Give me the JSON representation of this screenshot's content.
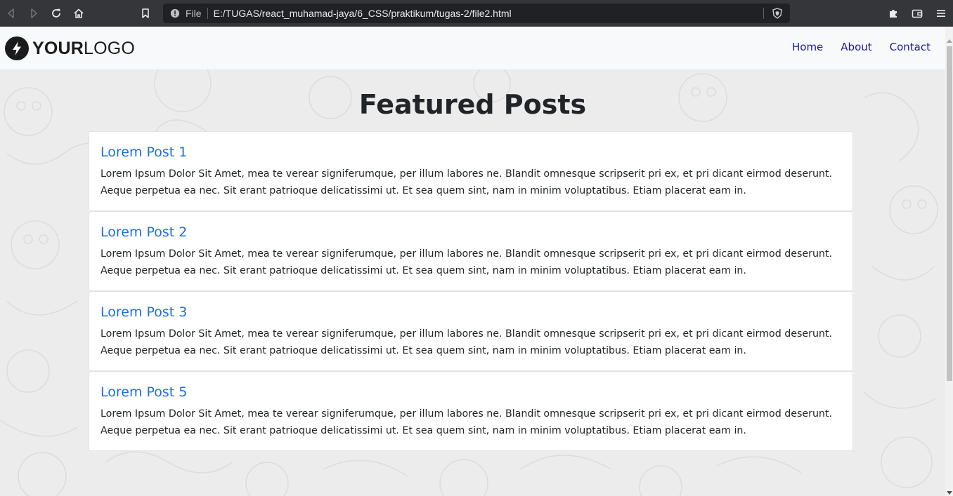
{
  "browser": {
    "url_scheme_label": "File",
    "url": "E:/TUGAS/react_muhamad-jaya/6_CSS/praktikum/tugas-2/file2.html"
  },
  "navbar": {
    "logo_bold": "YOUR",
    "logo_light": "LOGO",
    "links": [
      "Home",
      "About",
      "Contact"
    ]
  },
  "main": {
    "title": "Featured Posts",
    "posts": [
      {
        "title": "Lorem Post 1",
        "line1": "Lorem Ipsum Dolor Sit Amet, mea te verear signiferumque, per illum labores ne. Blandit omnesque scripserit pri ex, et pri dicant eirmod deserunt.",
        "line2": "Aeque perpetua ea nec. Sit erant patrioque delicatissimi ut. Et sea quem sint, nam in minim voluptatibus. Etiam placerat eam in."
      },
      {
        "title": "Lorem Post 2",
        "line1": "Lorem Ipsum Dolor Sit Amet, mea te verear signiferumque, per illum labores ne. Blandit omnesque scripserit pri ex, et pri dicant eirmod deserunt.",
        "line2": "Aeque perpetua ea nec. Sit erant patrioque delicatissimi ut. Et sea quem sint, nam in minim voluptatibus. Etiam placerat eam in."
      },
      {
        "title": "Lorem Post 3",
        "line1": "Lorem Ipsum Dolor Sit Amet, mea te verear signiferumque, per illum labores ne. Blandit omnesque scripserit pri ex, et pri dicant eirmod deserunt.",
        "line2": "Aeque perpetua ea nec. Sit erant patrioque delicatissimi ut. Et sea quem sint, nam in minim voluptatibus. Etiam placerat eam in."
      },
      {
        "title": "Lorem Post 5",
        "line1": "Lorem Ipsum Dolor Sit Amet, mea te verear signiferumque, per illum labores ne. Blandit omnesque scripserit pri ex, et pri dicant eirmod deserunt.",
        "line2": "Aeque perpetua ea nec. Sit erant patrioque delicatissimi ut. Et sea quem sint, nam in minim voluptatibus. Etiam placerat eam in."
      }
    ]
  },
  "icons": {
    "back": "back-arrow-icon",
    "forward": "forward-arrow-icon",
    "reload": "reload-icon",
    "home": "home-icon",
    "bookmark": "bookmark-icon",
    "info": "info-icon",
    "shield": "brave-shield-icon",
    "extensions": "puzzle-icon",
    "wallet": "wallet-icon",
    "menu": "hamburger-menu-icon",
    "logo": "lightning-bolt-icon"
  },
  "colors": {
    "chrome_bg": "#35363a",
    "urlbar_bg": "#202124",
    "navbar_bg": "#f8f9fa",
    "link": "#1a1a9a",
    "post_title": "#1f6fd6",
    "page_bg": "#ececec"
  }
}
